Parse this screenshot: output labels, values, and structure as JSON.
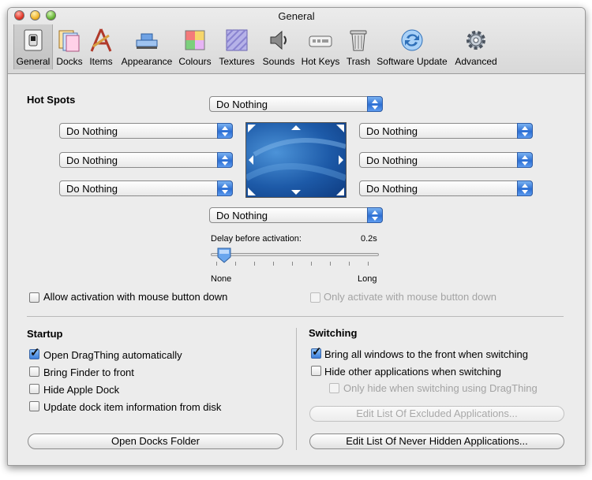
{
  "window": {
    "title": "General"
  },
  "toolbar": [
    {
      "label": "General",
      "icon": "general-switch-icon",
      "selected": true
    },
    {
      "label": "Docks",
      "icon": "docks-icon"
    },
    {
      "label": "Items",
      "icon": "items-icon"
    },
    {
      "label": "Appearance",
      "icon": "appearance-icon"
    },
    {
      "label": "Colours",
      "icon": "colours-icon"
    },
    {
      "label": "Textures",
      "icon": "textures-icon"
    },
    {
      "label": "Sounds",
      "icon": "speaker-icon"
    },
    {
      "label": "Hot Keys",
      "icon": "keyboard-icon"
    },
    {
      "label": "Trash",
      "icon": "trash-icon"
    },
    {
      "label": "Software Update",
      "icon": "software-update-icon"
    },
    {
      "label": "Advanced",
      "icon": "gear-icon"
    }
  ],
  "hot_spots": {
    "heading": "Hot Spots",
    "top": "Do Nothing",
    "top_left": "Do Nothing",
    "top_right": "Do Nothing",
    "left": "Do Nothing",
    "right": "Do Nothing",
    "bottom_left": "Do Nothing",
    "bottom_right": "Do Nothing",
    "bottom": "Do Nothing",
    "delay_label": "Delay before activation:",
    "delay_value": "0.2s",
    "slider_min_label": "None",
    "slider_max_label": "Long",
    "slider_fraction": 0.08,
    "allow_mouse_down": {
      "label": "Allow activation with mouse button down",
      "checked": false
    },
    "only_mouse_down": {
      "label": "Only activate with mouse button down",
      "checked": false,
      "disabled": true
    }
  },
  "startup": {
    "heading": "Startup",
    "options": [
      {
        "label": "Open DragThing automatically",
        "checked": true
      },
      {
        "label": "Bring Finder to front",
        "checked": false
      },
      {
        "label": "Hide Apple Dock",
        "checked": false
      },
      {
        "label": "Update dock item information from disk",
        "checked": false
      }
    ],
    "open_docks_button": "Open Docks Folder"
  },
  "switching": {
    "heading": "Switching",
    "bring_all": {
      "label": "Bring all windows to the front when switching",
      "checked": true
    },
    "hide_other": {
      "label": "Hide other applications when switching",
      "checked": false
    },
    "only_hide": {
      "label": "Only hide when switching using DragThing",
      "checked": false,
      "disabled": true
    },
    "excluded_button": "Edit List Of Excluded Applications...",
    "never_hidden_button": "Edit List Of Never Hidden Applications..."
  }
}
